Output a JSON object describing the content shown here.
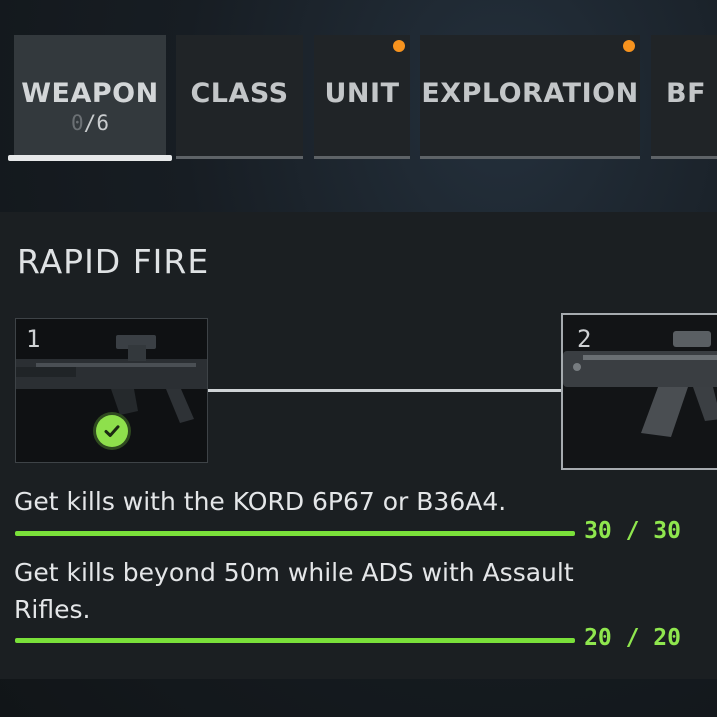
{
  "tabs": [
    {
      "label": "WEAPON",
      "count_done": "0",
      "count_total": "/6",
      "active": true,
      "notification": false
    },
    {
      "label": "CLASS",
      "active": false,
      "notification": false
    },
    {
      "label": "UNIT",
      "active": false,
      "notification": true
    },
    {
      "label": "EXPLORATION",
      "active": false,
      "notification": true
    },
    {
      "label": "BF I",
      "active": false,
      "notification": false
    }
  ],
  "colors": {
    "accent_green": "#7ae03a",
    "notification_orange": "#f7931e"
  },
  "assignment": {
    "title": "RAPID FIRE",
    "steps": [
      {
        "number": "1",
        "completed": true,
        "icon": "check-icon"
      },
      {
        "number": "2",
        "completed": false
      }
    ],
    "challenges": [
      {
        "text": "Get kills with the KORD 6P67 or B36A4.",
        "progress": "30 / 30",
        "fraction": 1.0
      },
      {
        "text": "Get kills beyond 50m while ADS with Assault Rifles.",
        "progress": "20 / 20",
        "fraction": 1.0
      }
    ]
  }
}
